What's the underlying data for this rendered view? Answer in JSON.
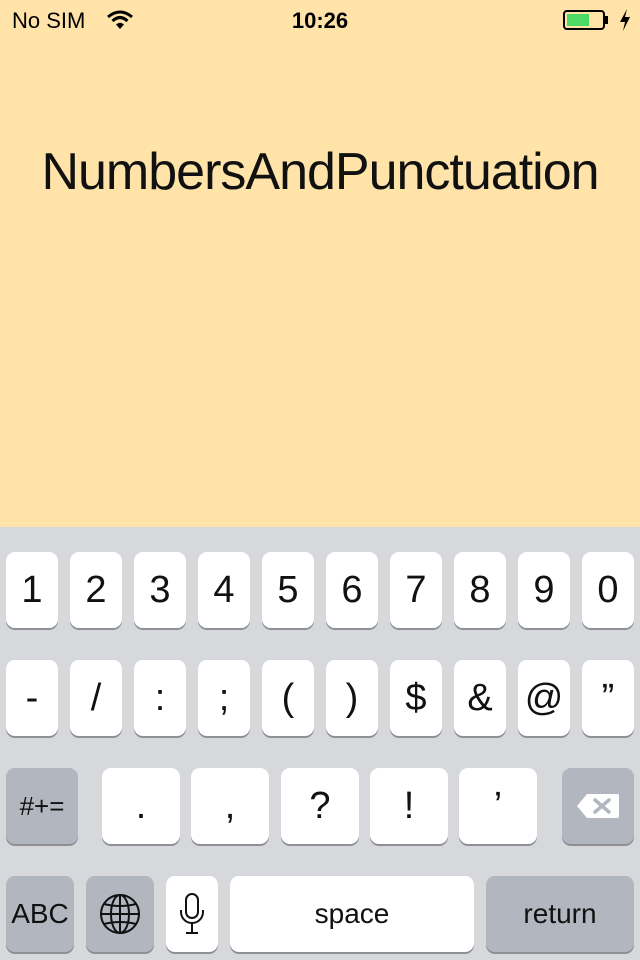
{
  "status": {
    "carrier": "No SIM",
    "time": "10:26",
    "battery_color": "#4cd964"
  },
  "screen": {
    "title": "NumbersAndPunctuation"
  },
  "keyboard": {
    "row1": [
      "1",
      "2",
      "3",
      "4",
      "5",
      "6",
      "7",
      "8",
      "9",
      "0"
    ],
    "row2": [
      "-",
      "/",
      ":",
      ";",
      "(",
      ")",
      "$",
      "&",
      "@",
      "”"
    ],
    "row3": {
      "more_symbols": "#+=",
      "keys": [
        ".",
        ",",
        "?",
        "!",
        "’"
      ],
      "delete_icon": "delete-icon"
    },
    "row4": {
      "abc": "ABC",
      "globe_icon": "globe-icon",
      "mic_icon": "microphone-icon",
      "space": "space",
      "return": "return"
    }
  }
}
